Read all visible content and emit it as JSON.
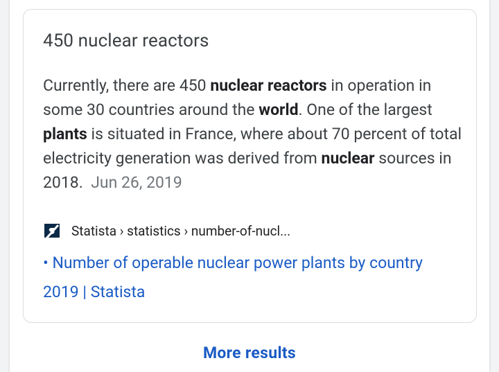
{
  "card": {
    "title": "450 nuclear reactors",
    "snippet": {
      "t1": "Currently, there are 450 ",
      "b1": "nuclear reactors",
      "t2": " in operation in some 30 countries around the ",
      "b2": "world",
      "t3": ". One of the largest ",
      "b3": "plants",
      "t4": " is situated in France, where about 70 percent of total electricity generation was derived from ",
      "b4": "nuclear",
      "t5": " sources in 2018.",
      "date": "Jun 26, 2019"
    },
    "source": {
      "icon": "statista-favicon-icon",
      "breadcrumb": "Statista › statistics › number-of-nucl..."
    },
    "link": {
      "bullet": "•",
      "title": "Number of operable nuclear power plants by country 2019 | Statista"
    }
  },
  "more_results_label": "More results",
  "colors": {
    "link": "#1a5bc4",
    "text": "#3c4043",
    "muted": "#70757a",
    "border": "#dadce0",
    "favicon": "#0b2a47"
  }
}
